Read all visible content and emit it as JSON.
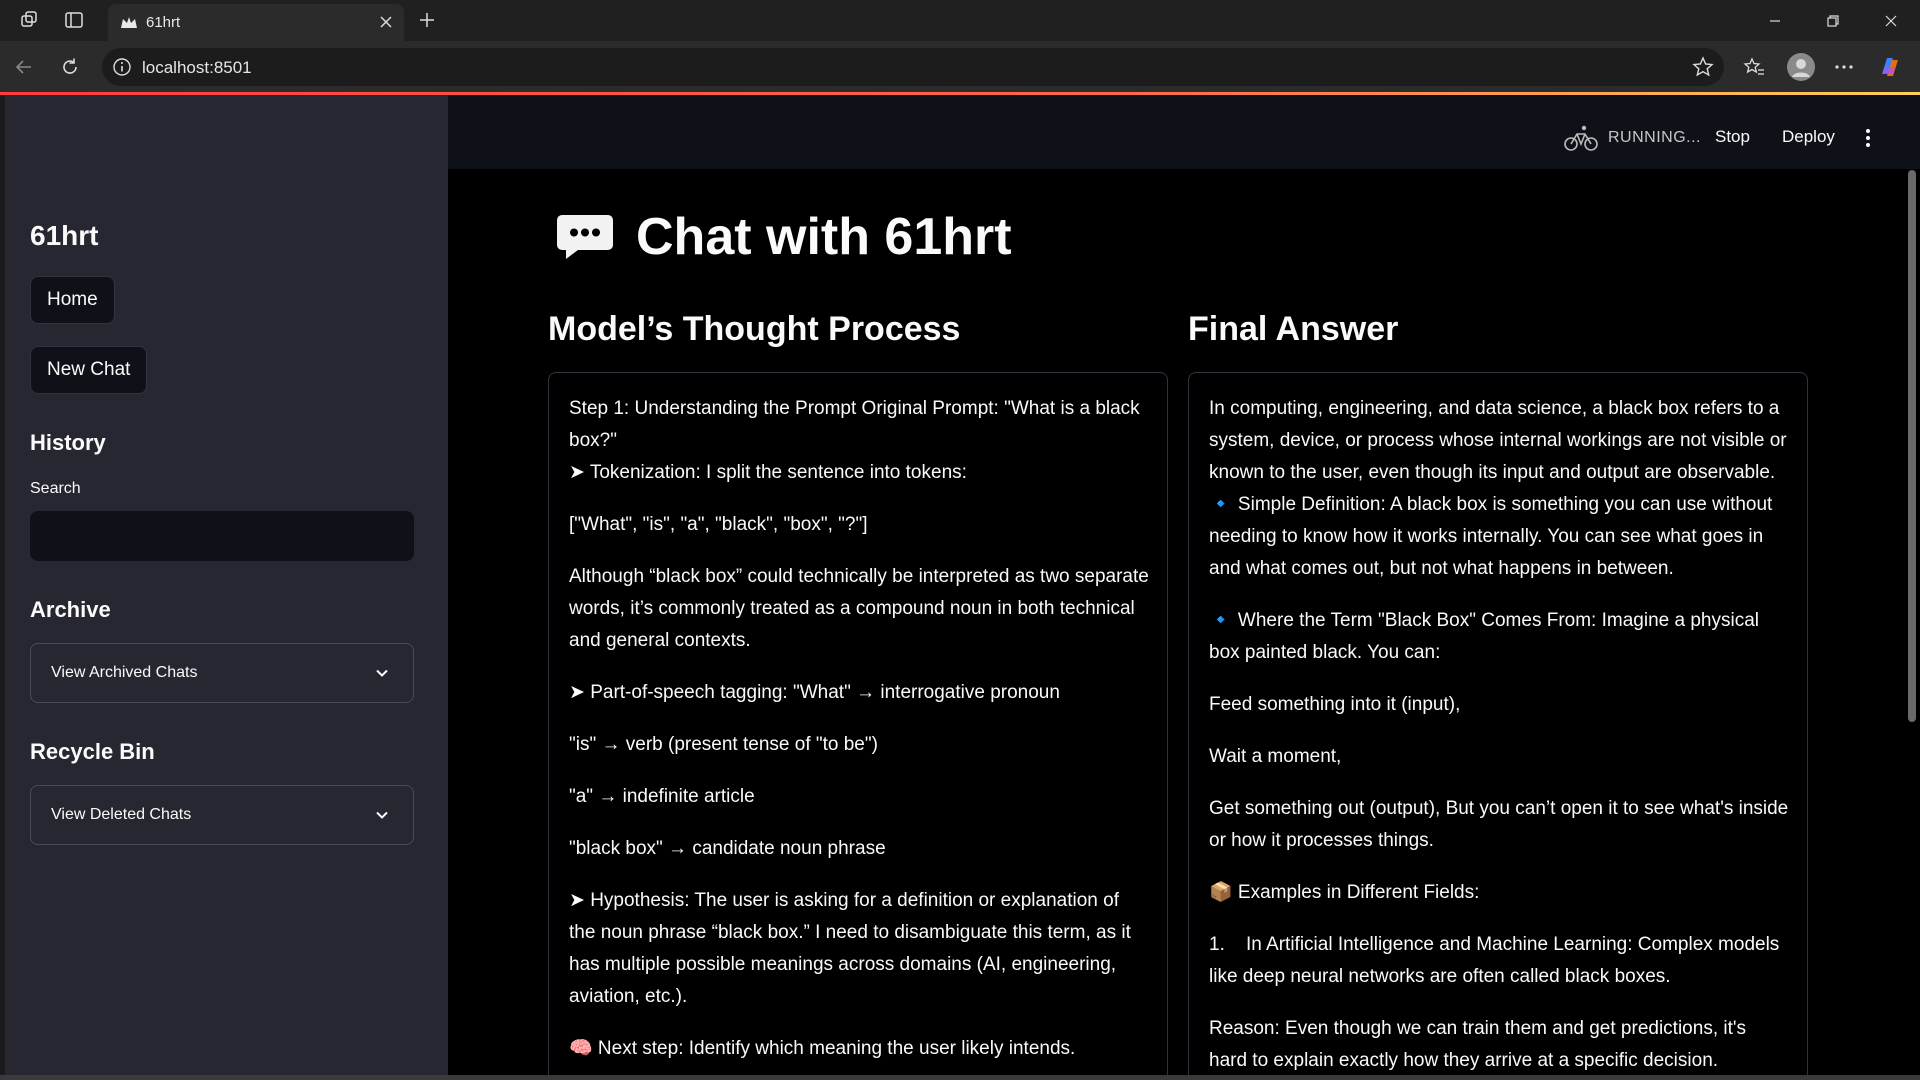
{
  "browser": {
    "tab_title": "61hrt",
    "url": "localhost:8501"
  },
  "sidebar": {
    "app_title": "61hrt",
    "home_label": "Home",
    "new_chat_label": "New Chat",
    "history_heading": "History",
    "search_label": "Search",
    "search_value": "",
    "archive_heading": "Archive",
    "archive_expander": "View Archived Chats",
    "recycle_heading": "Recycle Bin",
    "recycle_expander": "View Deleted Chats"
  },
  "header": {
    "status": "RUNNING...",
    "stop_label": "Stop",
    "deploy_label": "Deploy"
  },
  "main": {
    "title": "Chat with 61hrt",
    "thought_heading": "Model’s Thought Process",
    "answer_heading": "Final Answer",
    "thought_paragraphs": [
      "Step 1: Understanding the Prompt Original Prompt: \"What is a black box?\"",
      "➤ Tokenization: I split the sentence into tokens:",
      "[\"What\", \"is\", \"a\", \"black\", \"box\", \"?\"]",
      "Although “black box” could technically be interpreted as two separate words, it’s commonly treated as a compound noun in both technical and general contexts.",
      "➤ Part-of-speech tagging: \"What\" → interrogative pronoun",
      "\"is\" → verb (present tense of \"to be\")",
      "\"a\" → indefinite article",
      "\"black box\" → candidate noun phrase",
      "➤ Hypothesis: The user is asking for a definition or explanation of the noun phrase “black box.” I need to disambiguate this term, as it has multiple possible meanings across domains (AI, engineering, aviation, etc.).",
      "🧠 Next step: Identify which meaning the user likely intends."
    ],
    "answer_paragraphs": [
      "In computing, engineering, and data science, a black box refers to a system, device, or process whose internal workings are not visible or known to the user, even though its input and output are observable.",
      "🔹 Simple Definition: A black box is something you can use without needing to know how it works internally. You can see what goes in and what comes out, but not what happens in between.",
      "🔹 Where the Term \"Black Box\" Comes From: Imagine a physical box painted black. You can:",
      "Feed something into it (input),",
      "Wait a moment,",
      "Get something out (output), But you can’t open it to see what's inside or how it processes things.",
      "📦 Examples in Different Fields:",
      "1.    In Artificial Intelligence and Machine Learning: Complex models like deep neural networks are often called black boxes.",
      "Reason: Even though we can train them and get predictions, it's hard to explain exactly how they arrive at a specific decision."
    ]
  },
  "colors": {
    "sidebar_bg": "#262730",
    "main_bg": "#000000",
    "header_bg": "#0e1117",
    "loadbar": "#ff3b3b"
  }
}
